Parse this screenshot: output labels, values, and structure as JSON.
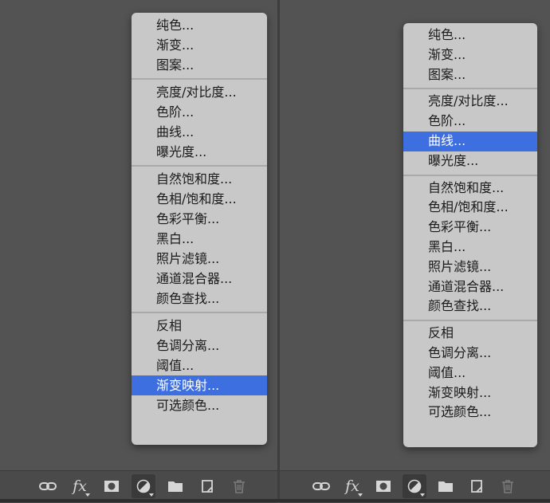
{
  "left_menu": {
    "groups": [
      [
        "纯色...",
        "渐变...",
        "图案..."
      ],
      [
        "亮度/对比度...",
        "色阶...",
        "曲线...",
        "曝光度..."
      ],
      [
        "自然饱和度...",
        "色相/饱和度...",
        "色彩平衡...",
        "黑白...",
        "照片滤镜...",
        "通道混合器...",
        "颜色查找..."
      ],
      [
        "反相",
        "色调分离...",
        "阈值...",
        "渐变映射...",
        "可选颜色..."
      ]
    ],
    "selected": "渐变映射..."
  },
  "right_menu": {
    "groups": [
      [
        "纯色...",
        "渐变...",
        "图案..."
      ],
      [
        "亮度/对比度...",
        "色阶...",
        "曲线...",
        "曝光度..."
      ],
      [
        "自然饱和度...",
        "色相/饱和度...",
        "色彩平衡...",
        "黑白...",
        "照片滤镜...",
        "通道混合器...",
        "颜色查找..."
      ],
      [
        "反相",
        "色调分离...",
        "阈值...",
        "渐变映射...",
        "可选颜色..."
      ]
    ],
    "selected": "曲线..."
  },
  "toolbar": {
    "icons": [
      "link-layers-icon",
      "fx-icon",
      "add-mask-icon",
      "adjustment-layer-icon",
      "group-folder-icon",
      "new-layer-icon",
      "trash-icon"
    ],
    "fx_label": "fx",
    "pressed": "adjustment-layer-icon",
    "disabled": [
      "trash-icon"
    ]
  },
  "colors": {
    "background": "#535353",
    "menu": "#c8c8c8",
    "highlight": "#3e6fe0"
  }
}
